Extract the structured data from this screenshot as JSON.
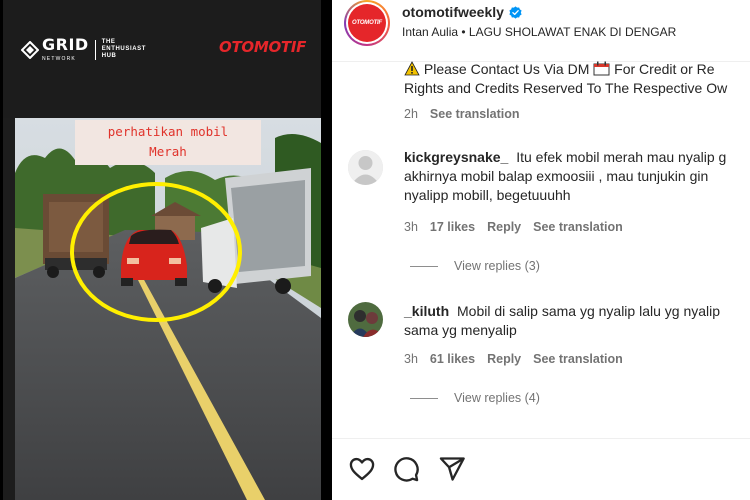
{
  "video": {
    "brand_grid": "GRID",
    "brand_grid_sub": "NETWORK",
    "brand_tagline_1": "THE",
    "brand_tagline_2": "ENTHUSIAST",
    "brand_tagline_3": "HUB",
    "brand_otomotif": "OTOMOTIF",
    "caption_line_1": "perhatikan mobil",
    "caption_line_2": "Merah",
    "highlight_color": "#ffef00",
    "caption_color": "#e0332b"
  },
  "post": {
    "avatar_text": "OTOMOTIF",
    "username": "otomotifweekly",
    "verified": true,
    "subtitle": "Intan Aulia • LAGU SHOLAWAT ENAK DI DENGAR",
    "caption": {
      "line_1": "Please Contact Us Via DM",
      "line_1b": "For Credit or Re",
      "line_2": "Rights and Credits Reserved To The Respective Ow",
      "time": "2h",
      "see_translation": "See translation"
    },
    "comments": [
      {
        "user": "kickgreysnake_",
        "line_1": "Itu efek mobil merah mau nyalip g",
        "line_2": "akhirnya mobil balap exmoosiii , mau tunjukin gin",
        "line_3": "nyalipp mobill, begetuuuhh",
        "time": "3h",
        "likes": "17 likes",
        "reply": "Reply",
        "see_translation": "See translation",
        "view_replies": "View replies (3)"
      },
      {
        "user": "_kiluth",
        "line_1": "Mobil di salip sama yg nyalip lalu yg nyalip",
        "line_2": "sama yg menyalip",
        "time": "3h",
        "likes": "61 likes",
        "reply": "Reply",
        "see_translation": "See translation",
        "view_replies": "View replies (4)"
      }
    ],
    "actions": [
      "heart-icon",
      "comment-icon",
      "share-icon"
    ],
    "accent_blue": "#0095f6",
    "text_primary": "#262626",
    "text_secondary": "#737373"
  }
}
